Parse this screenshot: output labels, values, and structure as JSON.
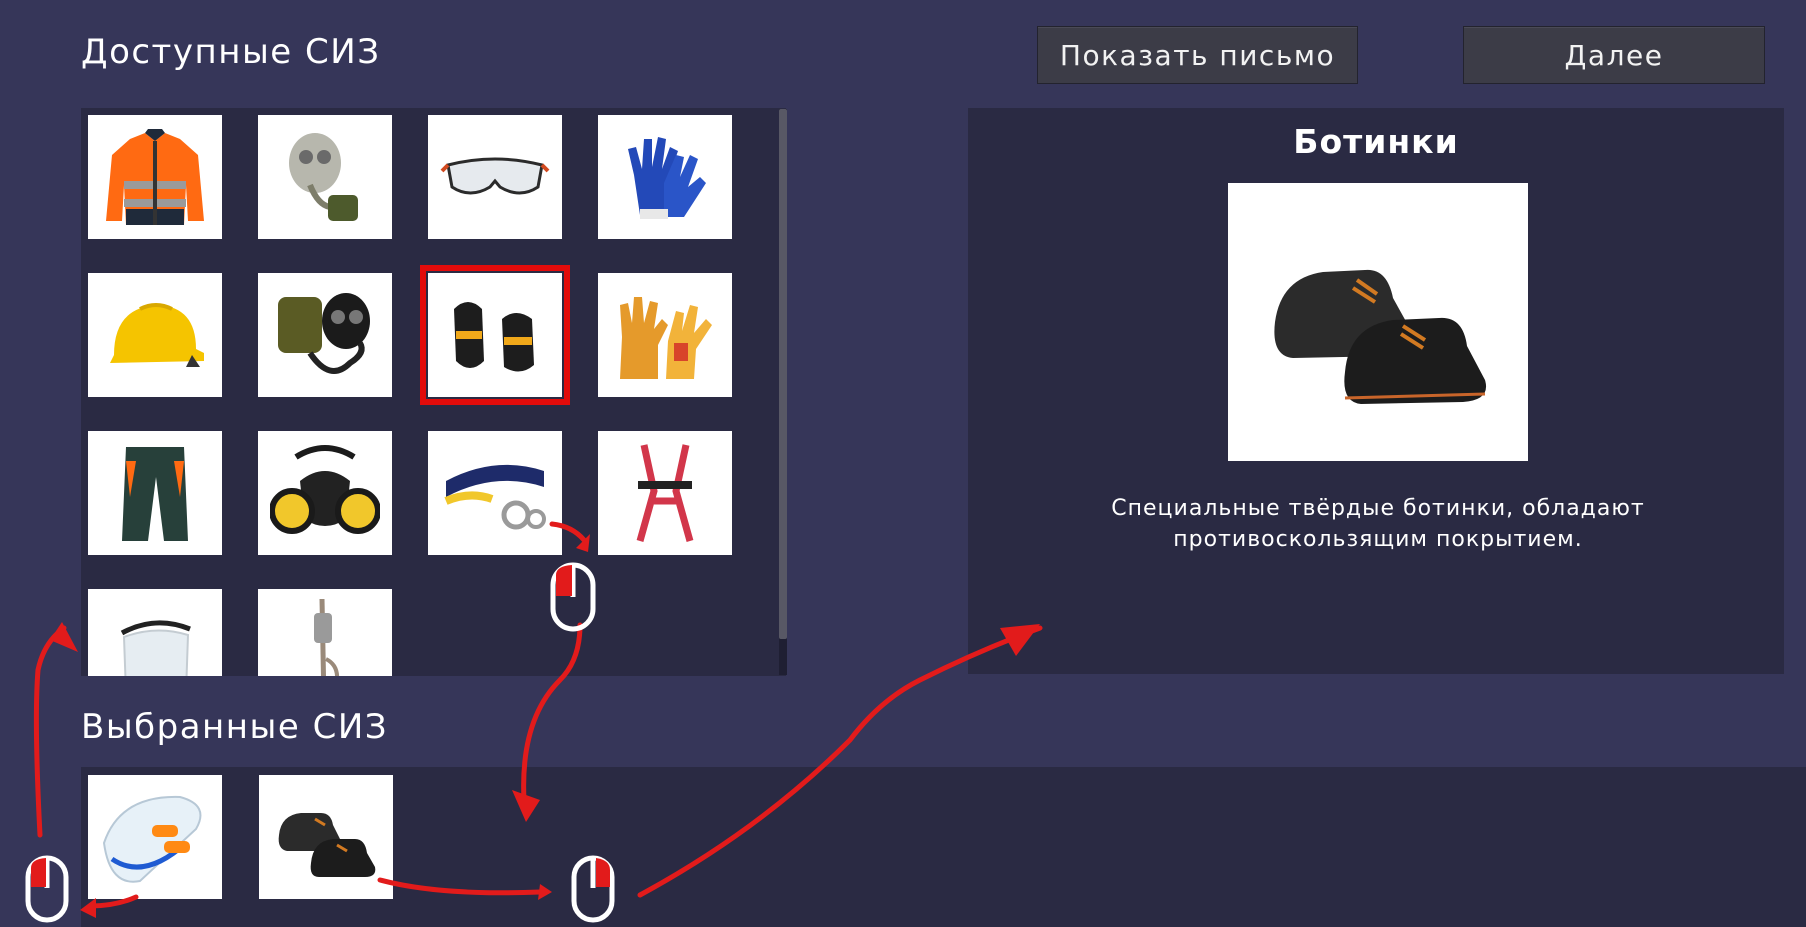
{
  "available": {
    "title": "Доступные СИЗ",
    "items": [
      {
        "name": "Сигнальная куртка",
        "icon": "hi-vis-jacket-icon"
      },
      {
        "name": "Противогаз",
        "icon": "gas-mask-icon"
      },
      {
        "name": "Защитные очки",
        "icon": "safety-glasses-icon"
      },
      {
        "name": "Перчатки",
        "icon": "work-gloves-icon"
      },
      {
        "name": "Каска",
        "icon": "hard-hat-icon"
      },
      {
        "name": "Изолирующий противогаз",
        "icon": "breathing-apparatus-icon"
      },
      {
        "name": "Наколенники",
        "icon": "knee-pads-icon"
      },
      {
        "name": "Краги сварщика",
        "icon": "welding-gloves-icon"
      },
      {
        "name": "Защитные брюки",
        "icon": "work-trousers-icon"
      },
      {
        "name": "Респиратор",
        "icon": "respirator-icon"
      },
      {
        "name": "Страховочный пояс",
        "icon": "safety-belt-icon"
      },
      {
        "name": "Страховочная привязь",
        "icon": "safety-harness-icon"
      },
      {
        "name": "Защитный щиток",
        "icon": "face-shield-icon"
      },
      {
        "name": "Страховочный трос",
        "icon": "lanyard-rope-icon"
      }
    ],
    "selected_index": 6
  },
  "buttons": {
    "show_letter": "Показать письмо",
    "next": "Далее"
  },
  "detail": {
    "title": "Ботинки",
    "icon": "safety-boots-icon",
    "description_line1": "Специальные твёрдые ботинки, обладают",
    "description_line2": "противоскользящим покрытием."
  },
  "chosen": {
    "title": "Выбранные СИЗ",
    "items": [
      {
        "name": "Беруши",
        "icon": "earplugs-icon"
      },
      {
        "name": "Ботинки",
        "icon": "safety-boots-icon"
      }
    ]
  },
  "colors": {
    "background": "#363659",
    "panel": "#2a2a43",
    "selection": "#e20b0b",
    "annotation": "#e21b1b"
  }
}
